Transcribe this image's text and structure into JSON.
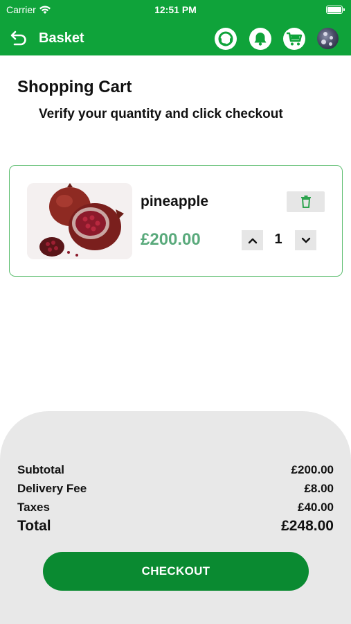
{
  "status_bar": {
    "carrier": "Carrier",
    "time": "12:51 PM"
  },
  "header": {
    "title": "Basket",
    "icons": [
      "back-arrow-icon",
      "support-chat-icon",
      "bell-icon",
      "cart-icon",
      "avatar"
    ],
    "brand_color": "#0fa33a"
  },
  "page": {
    "title": "Shopping Cart",
    "subtitle": "Verify your quantity and click checkout"
  },
  "cart": {
    "items": [
      {
        "name": "pineapple",
        "price": "£200.00",
        "quantity": "1",
        "image_icon": "pomegranate-image"
      }
    ],
    "border_color": "#5cbd6f",
    "price_color": "#5aaa7c"
  },
  "summary": {
    "subtotal_label": "Subtotal",
    "subtotal_value": "£200.00",
    "delivery_label": "Delivery Fee",
    "delivery_value": "£8.00",
    "taxes_label": "Taxes",
    "taxes_value": "£40.00",
    "total_label": "Total",
    "total_value": "£248.00"
  },
  "checkout": {
    "label": "CHECKOUT",
    "color": "#0a8a31"
  }
}
